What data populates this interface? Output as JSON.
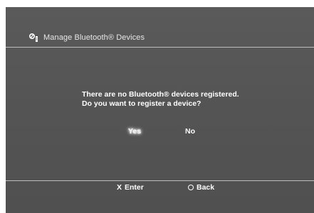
{
  "header": {
    "title": "Manage Bluetooth® Devices",
    "icon": "bluetooth-settings-icon"
  },
  "dialog": {
    "line1": "There are no Bluetooth® devices registered.",
    "line2": "Do you want to register a device?",
    "options": [
      {
        "label": "Yes",
        "selected": true
      },
      {
        "label": "No",
        "selected": false
      }
    ]
  },
  "footer": {
    "enter": {
      "button_glyph": "X",
      "label": "Enter"
    },
    "back": {
      "icon": "circle-button-icon",
      "label": "Back"
    }
  },
  "colors": {
    "background": "#545454",
    "text": "#ffffff",
    "divider": "#bdbdbd"
  }
}
